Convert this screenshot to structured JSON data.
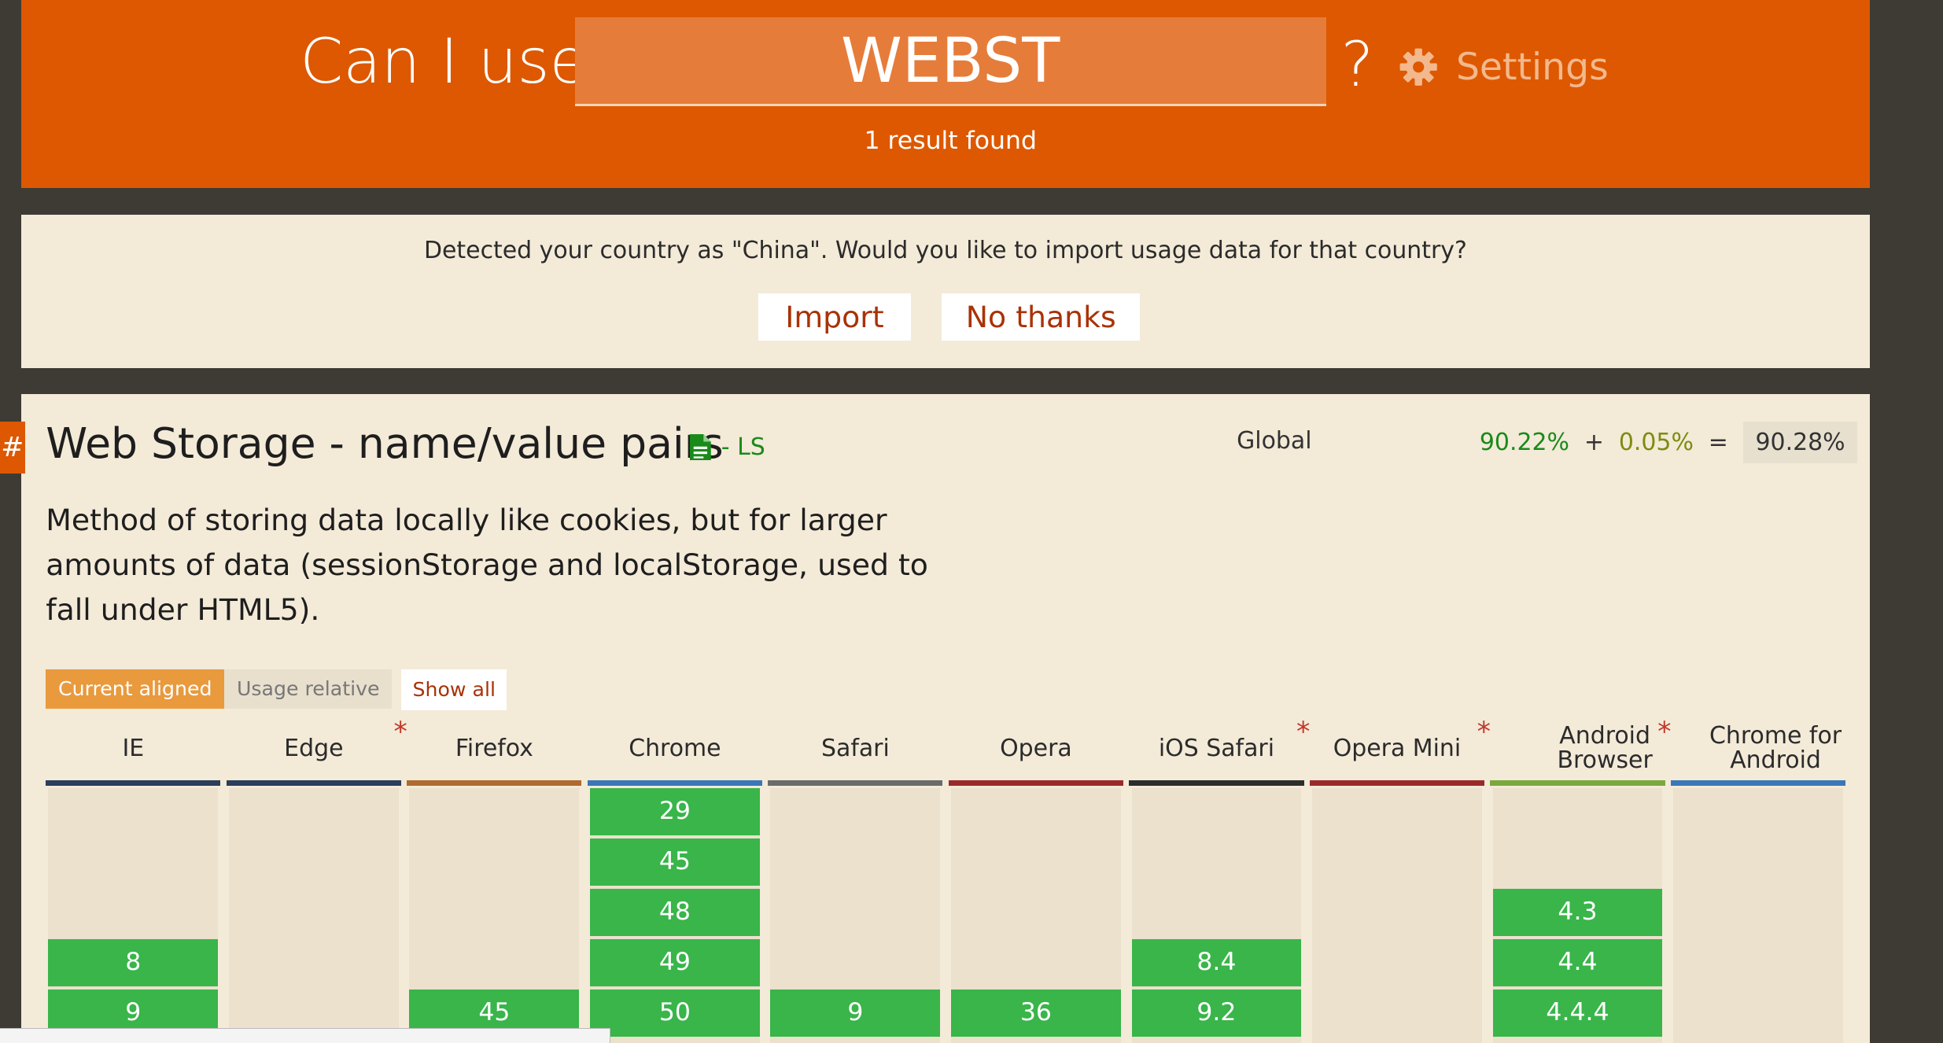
{
  "header": {
    "title": "Can I use",
    "search_value": "WEBST",
    "question_mark": "?",
    "settings_label": "Settings",
    "result_count": "1 result found"
  },
  "banner": {
    "message": "Detected your country as \"China\". Would you like to import usage data for that country?",
    "import_label": "Import",
    "no_thanks_label": "No thanks"
  },
  "feature": {
    "hash": "#",
    "title": "Web Storage - name/value pairs",
    "spec_label": "- LS",
    "region_label": "Global",
    "usage_full": "90.22%",
    "usage_plus": "+",
    "usage_partial": "0.05%",
    "usage_equals": "=",
    "usage_total": "90.28%",
    "description": "Method of storing data locally like cookies, but for larger amounts of data (sessionStorage and localStorage, used to fall under HTML5).",
    "view_current": "Current aligned",
    "view_usage": "Usage relative",
    "show_all_label": "Show all"
  },
  "browsers": [
    {
      "name": "IE",
      "color": "#2b3e5a",
      "note": false,
      "versions": [
        {
          "row": 3,
          "label": "8"
        },
        {
          "row": 4,
          "label": "9"
        }
      ]
    },
    {
      "name": "Edge",
      "color": "#2b3e5a",
      "note": true,
      "versions": []
    },
    {
      "name": "Firefox",
      "color": "#b06a2f",
      "note": false,
      "versions": [
        {
          "row": 4,
          "label": "45"
        }
      ]
    },
    {
      "name": "Chrome",
      "color": "#3a77b8",
      "note": false,
      "versions": [
        {
          "row": 0,
          "label": "29"
        },
        {
          "row": 1,
          "label": "45"
        },
        {
          "row": 2,
          "label": "48"
        },
        {
          "row": 3,
          "label": "49"
        },
        {
          "row": 4,
          "label": "50"
        }
      ]
    },
    {
      "name": "Safari",
      "color": "#6b6b6b",
      "note": false,
      "versions": [
        {
          "row": 4,
          "label": "9"
        }
      ]
    },
    {
      "name": "Opera",
      "color": "#9a2a2a",
      "note": false,
      "versions": [
        {
          "row": 4,
          "label": "36"
        }
      ]
    },
    {
      "name": "iOS Safari",
      "color": "#2d2d2d",
      "note": true,
      "versions": [
        {
          "row": 3,
          "label": "8.4"
        },
        {
          "row": 4,
          "label": "9.2"
        }
      ]
    },
    {
      "name": "Opera Mini",
      "color": "#9a2a2a",
      "note": true,
      "versions": []
    },
    {
      "name": "Android Browser",
      "color": "#7aa93c",
      "note": true,
      "versions": [
        {
          "row": 2,
          "label": "4.3"
        },
        {
          "row": 3,
          "label": "4.4"
        },
        {
          "row": 4,
          "label": "4.4.4"
        }
      ]
    },
    {
      "name": "Chrome for Android",
      "color": "#3a77b8",
      "note": false,
      "versions": []
    }
  ],
  "colors": {
    "brand_orange": "#dd5800",
    "supported_green": "#39b54a",
    "panel_beige": "#f3ead8"
  }
}
